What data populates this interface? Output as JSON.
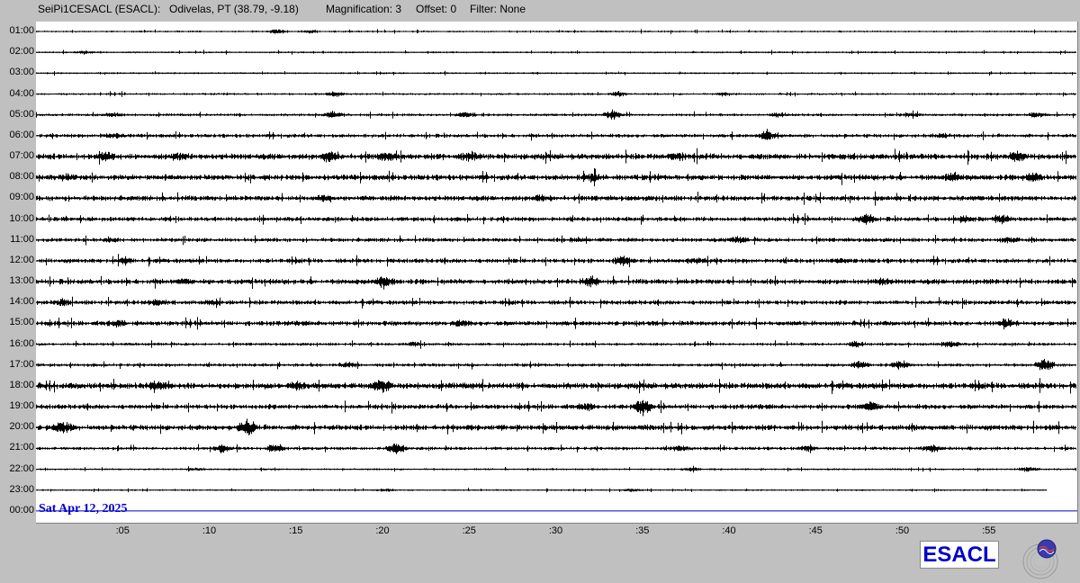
{
  "header": {
    "station": "SeiPi1CESACL (ESACL):",
    "location": "Odivelas, PT (38.79, -9.18)",
    "magnification": "Magnification: 3",
    "offset": "Offset: 0",
    "filter": "Filter: None"
  },
  "chart_data": {
    "type": "line",
    "title": "",
    "date": "Sat Apr 12, 2025",
    "y_tick_labels": [
      "01:00",
      "02:00",
      "03:00",
      "04:00",
      "05:00",
      "06:00",
      "07:00",
      "08:00",
      "09:00",
      "10:00",
      "11:00",
      "12:00",
      "13:00",
      "14:00",
      "15:00",
      "16:00",
      "17:00",
      "18:00",
      "19:00",
      "20:00",
      "21:00",
      "22:00",
      "23:00",
      "00:00"
    ],
    "x_tick_labels": [
      ":05",
      ":10",
      ":15",
      ":20",
      ":25",
      ":30",
      ":35",
      ":40",
      ":45",
      ":50",
      ":55"
    ],
    "x_ticks_minutes": [
      5,
      10,
      15,
      20,
      25,
      30,
      35,
      40,
      45,
      50,
      55
    ],
    "xlim": [
      0,
      60
    ],
    "rows": [
      {
        "hour": "01:00",
        "noise": 1.0,
        "events": [
          [
            13.9,
            3
          ],
          [
            15.8,
            2
          ]
        ]
      },
      {
        "hour": "02:00",
        "noise": 1.0,
        "events": [
          [
            2.8,
            2
          ]
        ]
      },
      {
        "hour": "03:00",
        "noise": 1.0,
        "events": []
      },
      {
        "hour": "04:00",
        "noise": 1.2,
        "events": [
          [
            17.3,
            3
          ],
          [
            33.6,
            3
          ],
          [
            39.7,
            2
          ]
        ]
      },
      {
        "hour": "05:00",
        "noise": 1.5,
        "events": [
          [
            4.4,
            2
          ],
          [
            17.1,
            4
          ],
          [
            24.8,
            3
          ],
          [
            33.3,
            6
          ],
          [
            42.9,
            2
          ],
          [
            50.5,
            2
          ],
          [
            57.7,
            3
          ]
        ]
      },
      {
        "hour": "06:00",
        "noise": 2.0,
        "events": [
          [
            4.3,
            2
          ],
          [
            42.1,
            5
          ],
          [
            52.3,
            2
          ]
        ]
      },
      {
        "hour": "07:00",
        "noise": 3.2,
        "events": [
          [
            4.0,
            4
          ],
          [
            8.2,
            3
          ],
          [
            17.0,
            5
          ],
          [
            20.3,
            4
          ],
          [
            25.0,
            5
          ],
          [
            37.0,
            3
          ],
          [
            56.6,
            5
          ]
        ]
      },
      {
        "hour": "08:00",
        "noise": 3.0,
        "events": [
          [
            1.8,
            3
          ],
          [
            32.1,
            4
          ],
          [
            53.0,
            4
          ],
          [
            57.5,
            5
          ]
        ]
      },
      {
        "hour": "09:00",
        "noise": 2.8,
        "events": [
          [
            16.7,
            3
          ],
          [
            29.2,
            2
          ]
        ]
      },
      {
        "hour": "10:00",
        "noise": 2.4,
        "events": [
          [
            47.9,
            6
          ],
          [
            53.6,
            4
          ],
          [
            55.8,
            4
          ]
        ]
      },
      {
        "hour": "11:00",
        "noise": 2.2,
        "events": [
          [
            4.2,
            2
          ],
          [
            31.3,
            2
          ],
          [
            40.5,
            3
          ],
          [
            56.1,
            3
          ]
        ]
      },
      {
        "hour": "12:00",
        "noise": 2.4,
        "events": [
          [
            5.1,
            3
          ],
          [
            33.8,
            5
          ],
          [
            38.1,
            3
          ],
          [
            46.5,
            2
          ]
        ]
      },
      {
        "hour": "13:00",
        "noise": 2.8,
        "events": [
          [
            8.6,
            3
          ],
          [
            20.0,
            6
          ],
          [
            32.0,
            5
          ],
          [
            48.8,
            3
          ]
        ]
      },
      {
        "hour": "14:00",
        "noise": 2.4,
        "events": [
          [
            1.5,
            3
          ],
          [
            7.0,
            3
          ],
          [
            10.2,
            2
          ]
        ]
      },
      {
        "hour": "15:00",
        "noise": 2.6,
        "events": [
          [
            4.7,
            3
          ],
          [
            24.5,
            3
          ],
          [
            56.0,
            4
          ]
        ]
      },
      {
        "hour": "16:00",
        "noise": 1.6,
        "events": [
          [
            21.7,
            2
          ],
          [
            47.3,
            3
          ],
          [
            52.8,
            4
          ]
        ]
      },
      {
        "hour": "17:00",
        "noise": 1.8,
        "events": [
          [
            18.0,
            3
          ],
          [
            47.5,
            4
          ],
          [
            49.9,
            5
          ],
          [
            58.2,
            8
          ]
        ]
      },
      {
        "hour": "18:00",
        "noise": 3.3,
        "events": [
          [
            7.0,
            6
          ],
          [
            15.0,
            4
          ],
          [
            20.0,
            6
          ]
        ]
      },
      {
        "hour": "19:00",
        "noise": 2.6,
        "events": [
          [
            31.7,
            4
          ],
          [
            35.0,
            9
          ],
          [
            48.2,
            6
          ]
        ]
      },
      {
        "hour": "20:00",
        "noise": 3.0,
        "events": [
          [
            1.5,
            6
          ],
          [
            12.2,
            9
          ]
        ]
      },
      {
        "hour": "21:00",
        "noise": 1.8,
        "events": [
          [
            10.7,
            4
          ],
          [
            13.8,
            5
          ],
          [
            20.8,
            7
          ],
          [
            37.2,
            3
          ],
          [
            44.5,
            3
          ],
          [
            51.7,
            5
          ]
        ]
      },
      {
        "hour": "22:00",
        "noise": 1.1,
        "events": [
          [
            9.2,
            2
          ],
          [
            37.8,
            3
          ],
          [
            57.3,
            3
          ]
        ]
      },
      {
        "hour": "23:00",
        "noise": 0.9,
        "events": [
          [
            20.2,
            2
          ],
          [
            34.4,
            2
          ]
        ]
      },
      {
        "hour": "00:00",
        "noise": 0.0,
        "events": []
      }
    ]
  },
  "logo": {
    "text": "ESACL"
  },
  "colors": {
    "background": "#c0c0c0",
    "plot_background": "#ffffff",
    "trace": "#000000",
    "current_line": "#0000cc",
    "date_text": "#0000cc",
    "logo_text": "#0000cc"
  }
}
